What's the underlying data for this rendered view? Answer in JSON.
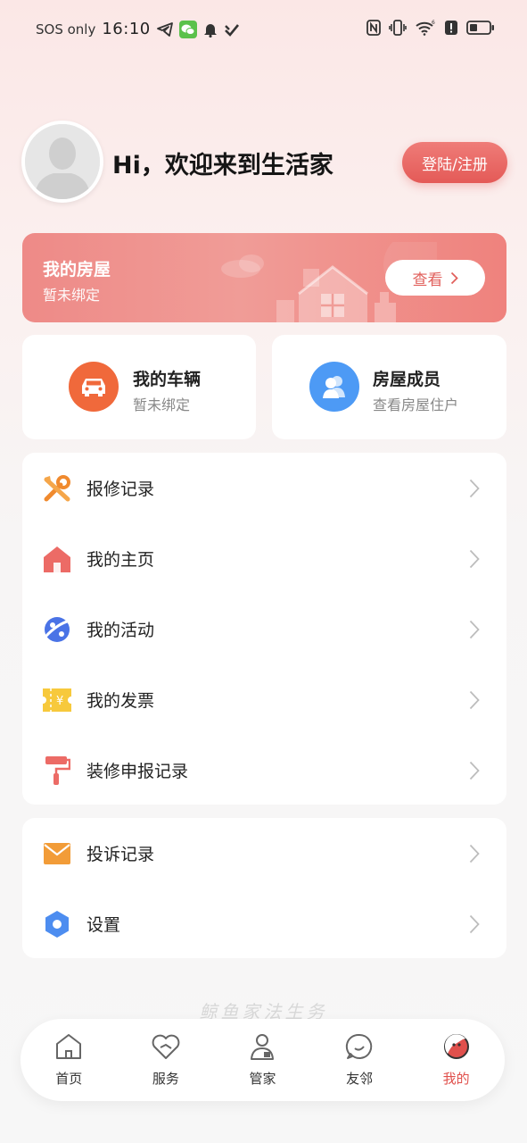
{
  "status_bar": {
    "network": "SOS only",
    "time": "16:10",
    "icons": [
      "telegram-icon",
      "wechat-icon",
      "bell-icon",
      "check-icon",
      "nfc-icon",
      "vibrate-icon",
      "wifi-icon",
      "alert-icon",
      "battery-icon"
    ]
  },
  "profile": {
    "greeting": "Hi，欢迎来到生活家",
    "login_label": "登陆/注册"
  },
  "house": {
    "title": "我的房屋",
    "subtitle": "暂未绑定",
    "view_label": "查看"
  },
  "cards": {
    "vehicle": {
      "title": "我的车辆",
      "subtitle": "暂未绑定",
      "color": "#f0693b"
    },
    "members": {
      "title": "房屋成员",
      "subtitle": "查看房屋住户",
      "color": "#4d9af5"
    }
  },
  "menu_primary": [
    {
      "label": "报修记录",
      "icon": "wrench-icon"
    },
    {
      "label": "我的主页",
      "icon": "home-icon"
    },
    {
      "label": "我的活动",
      "icon": "activity-icon"
    },
    {
      "label": "我的发票",
      "icon": "invoice-icon"
    },
    {
      "label": "装修申报记录",
      "icon": "paint-roller-icon"
    }
  ],
  "menu_secondary": [
    {
      "label": "投诉记录",
      "icon": "mail-icon"
    },
    {
      "label": "设置",
      "icon": "settings-icon"
    }
  ],
  "watermark": "鲸鱼家法生务",
  "tabs": [
    {
      "label": "首页",
      "icon": "home-tab-icon"
    },
    {
      "label": "服务",
      "icon": "service-tab-icon"
    },
    {
      "label": "管家",
      "icon": "butler-tab-icon"
    },
    {
      "label": "友邻",
      "icon": "neighbor-tab-icon"
    },
    {
      "label": "我的",
      "icon": "me-tab-icon",
      "active": true
    }
  ],
  "colors": {
    "accent": "#e45a57",
    "banner": "#ef8d89"
  }
}
